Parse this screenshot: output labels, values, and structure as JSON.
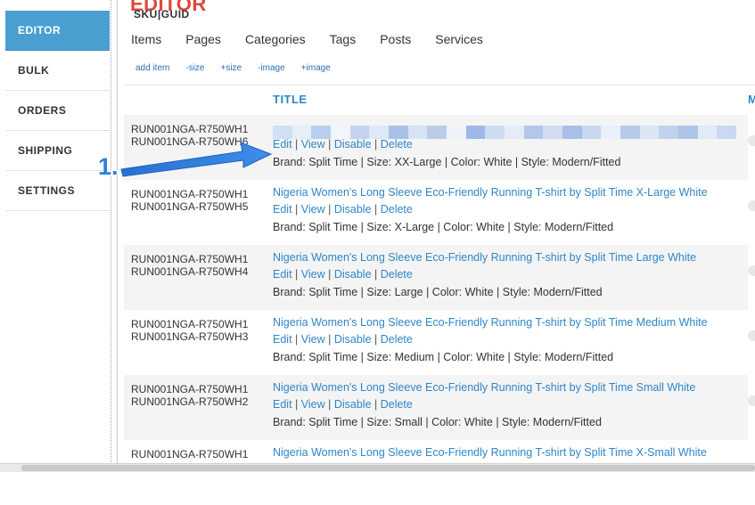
{
  "sidebar": {
    "items": [
      {
        "label": "EDITOR",
        "active": true
      },
      {
        "label": "BULK",
        "active": false
      },
      {
        "label": "ORDERS",
        "active": false
      },
      {
        "label": "SHIPPING",
        "active": false
      },
      {
        "label": "SETTINGS",
        "active": false
      }
    ]
  },
  "page": {
    "heading": "EDITOR",
    "tabs": [
      "Items",
      "Pages",
      "Categories",
      "Tags",
      "Posts",
      "Services"
    ],
    "actions": [
      "add item",
      "-size",
      "+size",
      "-image",
      "+image"
    ]
  },
  "table": {
    "columns": {
      "sku": "SKU|GUID",
      "title": "TITLE",
      "more": "M"
    },
    "link_labels": {
      "edit": "Edit",
      "view": "View",
      "disable": "Disable",
      "delete": "Delete",
      "sep": " | "
    },
    "rows": [
      {
        "sku": "RUN001NGA-R750WH1",
        "guid": "RUN001NGA-R750WH6",
        "title": "",
        "attrs": "Brand: Split Time | Size: XX-Large | Color: White | Style: Modern/Fitted",
        "obscured": true
      },
      {
        "sku": "RUN001NGA-R750WH1",
        "guid": "RUN001NGA-R750WH5",
        "title": "Nigeria Women's Long Sleeve Eco-Friendly Running T-shirt by Split Time X-Large White",
        "attrs": "Brand: Split Time | Size: X-Large | Color: White | Style: Modern/Fitted"
      },
      {
        "sku": "RUN001NGA-R750WH1",
        "guid": "RUN001NGA-R750WH4",
        "title": "Nigeria Women's Long Sleeve Eco-Friendly Running T-shirt by Split Time Large White",
        "attrs": "Brand: Split Time | Size: Large | Color: White | Style: Modern/Fitted"
      },
      {
        "sku": "RUN001NGA-R750WH1",
        "guid": "RUN001NGA-R750WH3",
        "title": "Nigeria Women's Long Sleeve Eco-Friendly Running T-shirt by Split Time Medium White",
        "attrs": "Brand: Split Time | Size: Medium | Color: White | Style: Modern/Fitted"
      },
      {
        "sku": "RUN001NGA-R750WH1",
        "guid": "RUN001NGA-R750WH2",
        "title": "Nigeria Women's Long Sleeve Eco-Friendly Running T-shirt by Split Time Small White",
        "attrs": "Brand: Split Time | Size: Small | Color: White | Style: Modern/Fitted"
      },
      {
        "sku": "RUN001NGA-R750WH1",
        "guid": "",
        "title": "Nigeria Women's Long Sleeve Eco-Friendly Running T-shirt by Split Time X-Small White",
        "attrs": ""
      }
    ]
  },
  "annotation": {
    "label": "1.",
    "color": "#2f7fd6"
  },
  "colors": {
    "accent": "#4a9fd0",
    "heading": "#e0463c",
    "link": "#2f86c8"
  },
  "blur_colors": [
    "#cfe0f3",
    "#e6eef8",
    "#b9cdee",
    "#f2f5fb",
    "#c4d3ef",
    "#dfe8f6",
    "#aac0ea",
    "#d7e3f4",
    "#bccbe6",
    "#eef3fa",
    "#9fb8e8",
    "#cddcf2",
    "#e4ecf7",
    "#b2c7ec",
    "#d2ddf1",
    "#a7bfe9",
    "#c9d8f0",
    "#e9f0f9",
    "#b6caeb",
    "#dbe6f5",
    "#c1d2ee",
    "#aec5ea",
    "#e1eaf6",
    "#cad9f1"
  ]
}
